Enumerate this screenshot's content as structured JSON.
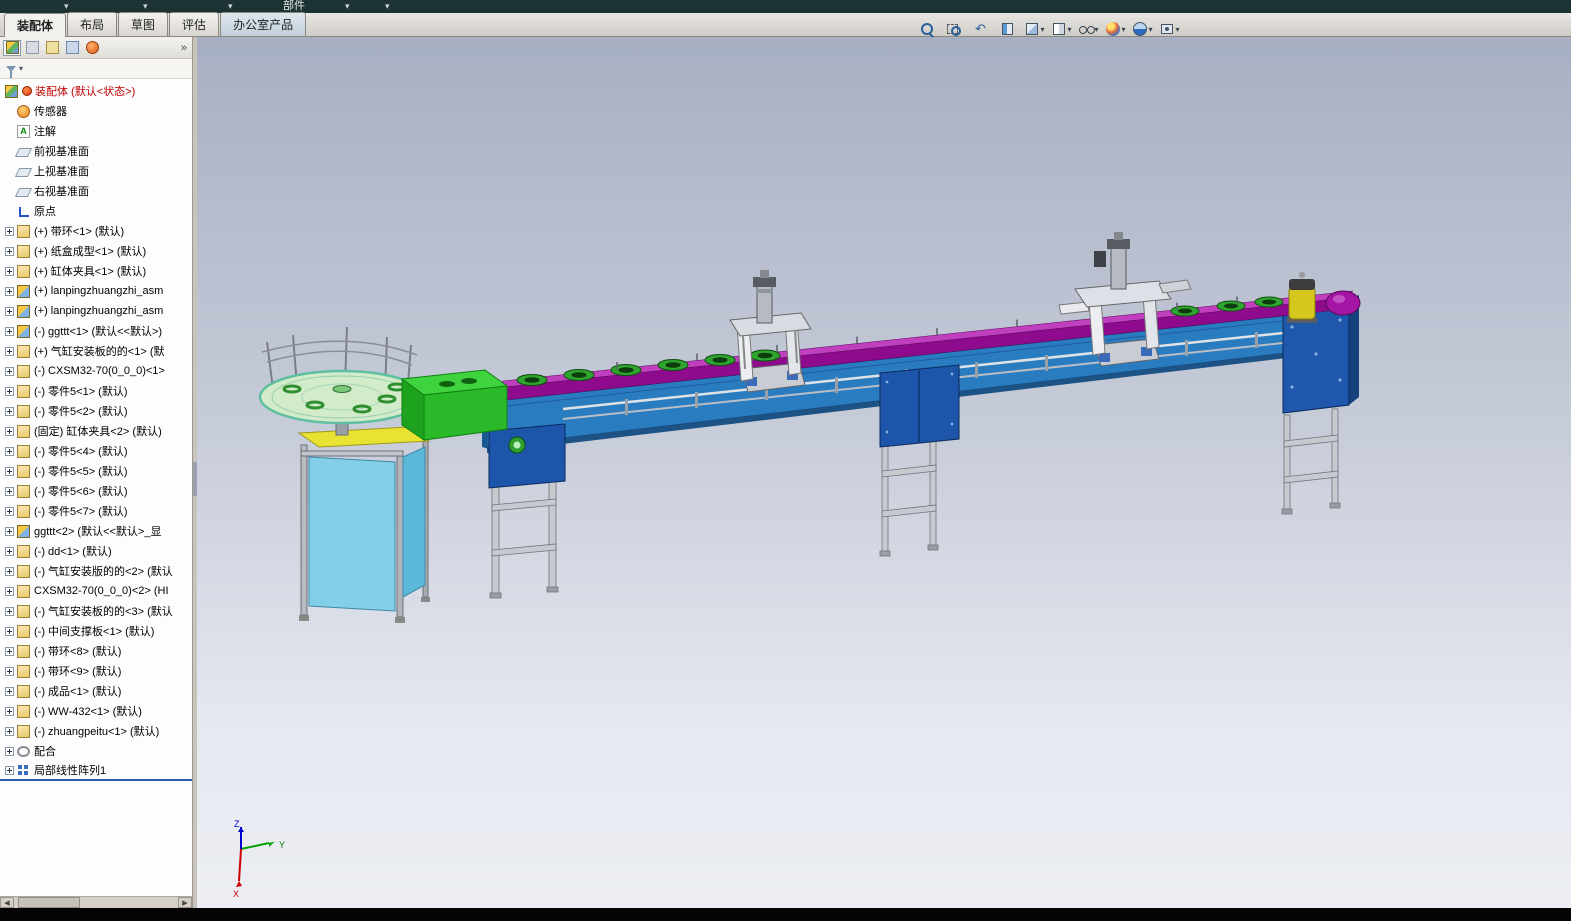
{
  "titlebar": {
    "part_label": "部件",
    "arrows": [
      "▾",
      "▾",
      "▾",
      "▾",
      "▾"
    ]
  },
  "command_tabs": [
    {
      "label": "装配体",
      "cls": "active",
      "name": "tab-assembly"
    },
    {
      "label": "布局",
      "cls": "",
      "name": "tab-layout"
    },
    {
      "label": "草图",
      "cls": "",
      "name": "tab-sketch"
    },
    {
      "label": "评估",
      "cls": "",
      "name": "tab-evaluate"
    },
    {
      "label": "办公室产品",
      "cls": "office",
      "name": "tab-office-products"
    }
  ],
  "hud": [
    {
      "name": "zoom-to-fit-icon",
      "cls": "i-zoomfit"
    },
    {
      "name": "zoom-to-area-icon",
      "cls": "i-zoomarea"
    },
    {
      "name": "previous-view-icon",
      "cls": "i-prev"
    },
    {
      "name": "section-view-icon",
      "cls": "i-section"
    },
    {
      "name": "view-orientation-icon",
      "cls": "i-orient",
      "dd": "▾"
    },
    {
      "name": "display-style-icon",
      "cls": "i-display",
      "dd": "▾"
    },
    {
      "name": "hide-show-items-icon",
      "cls": "i-hideshow",
      "dd": "▾"
    },
    {
      "name": "edit-appearance-icon",
      "cls": "i-appearance",
      "dd": "▾"
    },
    {
      "name": "apply-scene-icon",
      "cls": "i-scene",
      "dd": "▾"
    },
    {
      "name": "view-settings-icon",
      "cls": "i-settings",
      "dd": "▾"
    }
  ],
  "panel": {
    "tabs": [
      {
        "name": "featuremanager-tab-icon",
        "cls": "pt-feature activeTab"
      },
      {
        "name": "propertymanager-tab-icon",
        "cls": "pt-property"
      },
      {
        "name": "configurationmanager-tab-icon",
        "cls": "pt-config"
      },
      {
        "name": "dimxpertmanager-tab-icon",
        "cls": "pt-dimx"
      },
      {
        "name": "displaymanager-tab-icon",
        "cls": "pt-display"
      }
    ],
    "overflow": "»",
    "filter_dd": "▾"
  },
  "tree": {
    "items": [
      {
        "t": "装配体 (默认<状态>)",
        "i": "ic-asm",
        "i2": "ic-alert",
        "c": "red"
      },
      {
        "t": "传感器",
        "i": "ic-sensor",
        "sp": true
      },
      {
        "t": "注解",
        "i": "ic-anno",
        "sp": true
      },
      {
        "t": "前视基准面",
        "i": "ic-plane",
        "sp": true
      },
      {
        "t": "上视基准面",
        "i": "ic-plane",
        "sp": true
      },
      {
        "t": "右视基准面",
        "i": "ic-plane",
        "sp": true
      },
      {
        "t": "原点",
        "i": "ic-origin",
        "sp": true
      },
      {
        "t": "(+) 带环<1> (默认)",
        "i": "ic-part",
        "e": true
      },
      {
        "t": "(+) 纸盒成型<1> (默认)",
        "i": "ic-part",
        "e": true
      },
      {
        "t": "(+) 缸体夹具<1> (默认)",
        "i": "ic-part",
        "e": true
      },
      {
        "t": "(+) lanpingzhuangzhi_asm",
        "i": "ic-subasm",
        "e": true
      },
      {
        "t": "(+) lanpingzhuangzhi_asm",
        "i": "ic-subasm",
        "e": true
      },
      {
        "t": "(-) ggttt<1> (默认<<默认>)",
        "i": "ic-subasm",
        "e": true
      },
      {
        "t": "(+) 气缸安装板的的<1> (默",
        "i": "ic-part",
        "e": true
      },
      {
        "t": "(-) CXSM32-70(0_0_0)<1>",
        "i": "ic-part",
        "e": true
      },
      {
        "t": "(-) 零件5<1> (默认)",
        "i": "ic-part",
        "e": true
      },
      {
        "t": "(-) 零件5<2> (默认)",
        "i": "ic-part",
        "e": true
      },
      {
        "t": "(固定) 缸体夹具<2> (默认)",
        "i": "ic-part",
        "e": true
      },
      {
        "t": "(-) 零件5<4> (默认)",
        "i": "ic-part",
        "e": true
      },
      {
        "t": "(-) 零件5<5> (默认)",
        "i": "ic-part",
        "e": true
      },
      {
        "t": "(-) 零件5<6> (默认)",
        "i": "ic-part",
        "e": true
      },
      {
        "t": "(-) 零件5<7> (默认)",
        "i": "ic-part",
        "e": true
      },
      {
        "t": "ggttt<2> (默认<<默认>_显",
        "i": "ic-subasm",
        "e": true
      },
      {
        "t": "(-) dd<1> (默认)",
        "i": "ic-part",
        "e": true
      },
      {
        "t": "(-) 气缸安装版的的<2> (默认",
        "i": "ic-part",
        "e": true
      },
      {
        "t": "CXSM32-70(0_0_0)<2> (HI",
        "i": "ic-part",
        "e": true
      },
      {
        "t": "(-) 气缸安装板的的<3> (默认",
        "i": "ic-part",
        "e": true
      },
      {
        "t": "(-) 中间支撑板<1> (默认)",
        "i": "ic-part",
        "e": true
      },
      {
        "t": "(-) 带环<8> (默认)",
        "i": "ic-part",
        "e": true
      },
      {
        "t": "(-) 带环<9> (默认)",
        "i": "ic-part",
        "e": true
      },
      {
        "t": "(-) 成品<1> (默认)",
        "i": "ic-part",
        "e": true
      },
      {
        "t": "(-) WW-432<1> (默认)",
        "i": "ic-part",
        "e": true
      },
      {
        "t": "(-) zhuangpeitu<1> (默认)",
        "i": "ic-part",
        "e": true
      },
      {
        "t": "配合",
        "i": "ic-mates",
        "e": true
      },
      {
        "t": "局部线性阵列1",
        "i": "ic-pattern",
        "e": true,
        "c": "drop-target"
      }
    ]
  },
  "tree_scroll": {
    "left": "◀",
    "right": "▶"
  },
  "triad": {
    "x": "X",
    "y": "Y",
    "z": "Z"
  },
  "scene": {
    "colors": {
      "belt_magenta": "#8e0b8e",
      "belt_top": "#bf3fbf",
      "frame_blue": "#2a7cc0",
      "drive_box_blue": "#1d55aa",
      "ring_green": "#2fa42f",
      "chute_green": "#3fd43f",
      "table_green": "#d2ecca",
      "cabinet_cyan": "#84cfe8",
      "cabinet_top_yellow": "#e8e232",
      "motor_yellow": "#d6c71f",
      "leg_gray": "#c6cad0"
    }
  }
}
